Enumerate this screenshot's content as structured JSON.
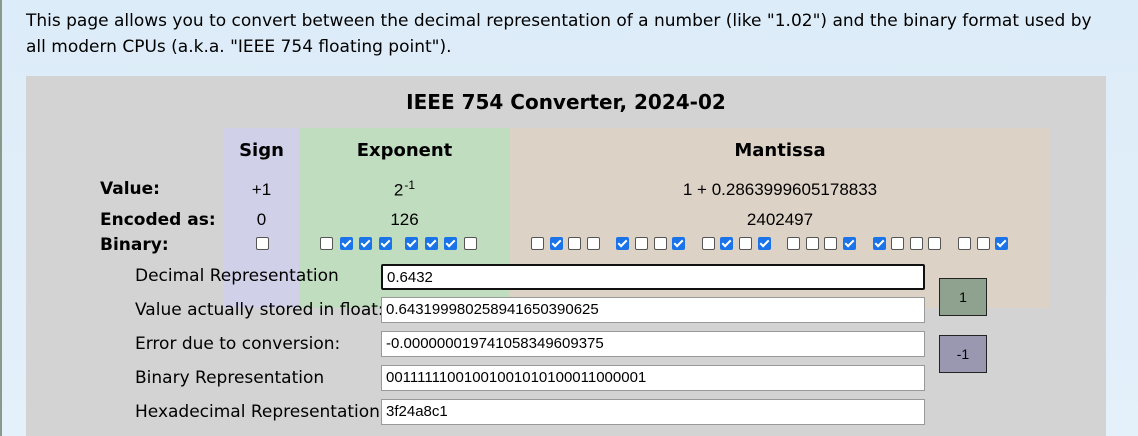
{
  "intro": "This page allows you to convert between the decimal representation of a number (like \"1.02\") and the binary format used by all modern CPUs (a.k.a. \"IEEE 754 floating point\").",
  "converter": {
    "title": "IEEE 754 Converter, 2024-02",
    "headers": {
      "sign": "Sign",
      "exponent": "Exponent",
      "mantissa": "Mantissa"
    },
    "row_labels": {
      "value": "Value:",
      "encoded": "Encoded as:",
      "binary": "Binary:"
    },
    "sign": {
      "value": "+1",
      "encoded": "0"
    },
    "exponent": {
      "value_base": "2",
      "value_power": "-1",
      "encoded": "126"
    },
    "mantissa": {
      "value": "1 + 0.2863999605178833",
      "encoded": "2402497"
    },
    "bits": [
      0,
      0,
      1,
      1,
      1,
      1,
      1,
      1,
      0,
      0,
      1,
      0,
      0,
      1,
      0,
      0,
      1,
      0,
      1,
      0,
      1,
      0,
      0,
      0,
      1,
      1,
      0,
      0,
      0,
      0,
      0,
      1
    ]
  },
  "fields": {
    "decimal_label": "Decimal Representation",
    "decimal_value": "0.6432",
    "stored_label": "Value actually stored in float:",
    "stored_value": "0.64319998025894165039062 5",
    "error_label": "Error due to conversion:",
    "error_value": "-0.0000000197410583496093 75",
    "binary_label": "Binary Representation",
    "binary_value": "00111111001001001010100011000001",
    "hex_label": "Hexadecimal Representation",
    "hex_value": "3f24a8c1"
  },
  "buttons": {
    "plus_one": "1",
    "minus_one": "-1"
  },
  "colors": {
    "sign_bg": "#d0d0e8",
    "exponent_bg": "#c0ddc0",
    "mantissa_bg": "#ddd2c6",
    "plus_btn": "#8fa28f",
    "minus_btn": "#9a98b0",
    "checkbox_on": "#1a73e8"
  }
}
